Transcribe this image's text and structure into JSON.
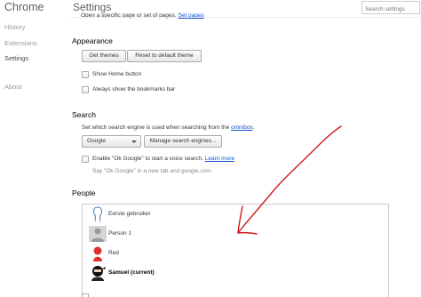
{
  "nav": {
    "app_title": "Chrome",
    "items": [
      {
        "label": "History",
        "selected": false
      },
      {
        "label": "Extensions",
        "selected": false
      },
      {
        "label": "Settings",
        "selected": true
      },
      {
        "label": "About",
        "selected": false
      }
    ]
  },
  "header": {
    "title": "Settings",
    "search_placeholder": "Search settings"
  },
  "on_startup": {
    "clipped_option": "Open a specific page or set of pages.",
    "set_pages_link": "Set pages"
  },
  "appearance": {
    "title": "Appearance",
    "get_themes": "Get themes",
    "reset_theme": "Reset to default theme",
    "show_home": "Show Home button",
    "show_bookmarks": "Always show the bookmarks bar"
  },
  "search": {
    "title": "Search",
    "description": "Set which search engine is used when searching from the",
    "omnibox_link": "omnibox",
    "engine_selected": "Google",
    "manage_engines": "Manage search engines...",
    "ok_google": "Enable \"Ok Google\" to start a voice search.",
    "learn_more": "Learn more",
    "ok_google_hint": "Say \"Ok Google\" in a new tab and google.com."
  },
  "people": {
    "title": "People",
    "profiles": [
      {
        "name": "Eerste gebruiker",
        "avatar": "outline-head-icon",
        "current": false
      },
      {
        "name": "Person 1",
        "avatar": "grey-person-icon",
        "current": false
      },
      {
        "name": "Red",
        "avatar": "red-person-icon",
        "current": false
      },
      {
        "name": "Samuel (current)",
        "avatar": "ninja-icon",
        "current": true
      }
    ]
  },
  "colors": {
    "link": "#1155cc",
    "annotation_arrow": "#d11a1a"
  }
}
